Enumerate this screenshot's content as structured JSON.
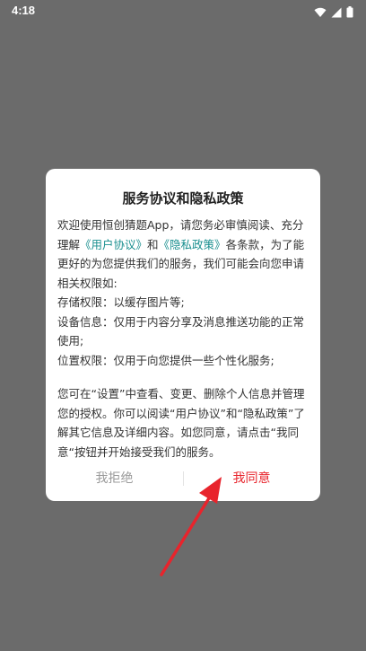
{
  "status_bar": {
    "time": "4:18",
    "icons": [
      "wifi-icon",
      "cellular-signal-icon",
      "battery-icon"
    ]
  },
  "dialog": {
    "title": "服务协议和隐私政策",
    "intro_before": "欢迎使用恒创猜题App，请您务必审慎阅读、充分理解",
    "user_agreement_link": "《用户协议》",
    "and_text": "和",
    "privacy_policy_link": "《隐私政策》",
    "intro_after": "各条款，为了能更好的为您提供我们的服务，我们可能会向您申请相关权限如:",
    "permissions": [
      "存储权限：以缓存图片等;",
      "设备信息：仅用于内容分享及消息推送功能的正常使用;",
      "位置权限：仅用于向您提供一些个性化服务;"
    ],
    "notice": "您可在“设置”中查看、变更、删除个人信息并管理您的授权。你可以阅读“用户协议”和“隐私政策”了解其它信息及详细内容。如您同意，请点击“我同意“按钮并开始接受我们的服务。",
    "reject_label": "我拒绝",
    "agree_label": "我同意"
  },
  "colors": {
    "overlay": "#6b6b6b",
    "link": "#1a8f8f",
    "agree": "#e8242c",
    "reject": "#9a9a9a",
    "arrow": "#e8242c"
  }
}
